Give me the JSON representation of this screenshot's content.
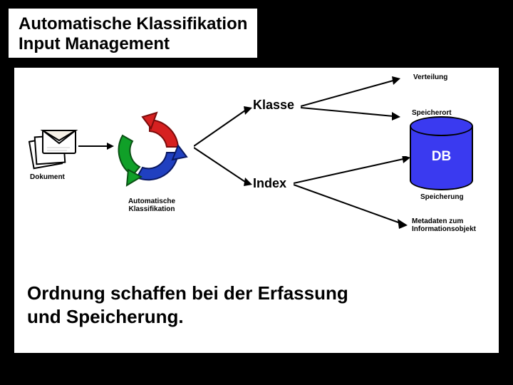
{
  "title": {
    "line1": "Automatische Klassifikation",
    "line2": "Input Management"
  },
  "diagram": {
    "doc_label": "Dokument",
    "classify_label_l1": "Automatische",
    "classify_label_l2": "Klassifikation",
    "branch_top": "Klasse",
    "branch_bottom": "Index",
    "out1": "Verteilung",
    "out2": "Speicherort",
    "db_label": "DB",
    "db_caption": "Speicherung",
    "out3_l1": "Metadaten zum",
    "out3_l2": "Informationsobjekt"
  },
  "caption": {
    "l1": "Ordnung schaffen bei der Erfassung",
    "l2": "und Speicherung."
  }
}
